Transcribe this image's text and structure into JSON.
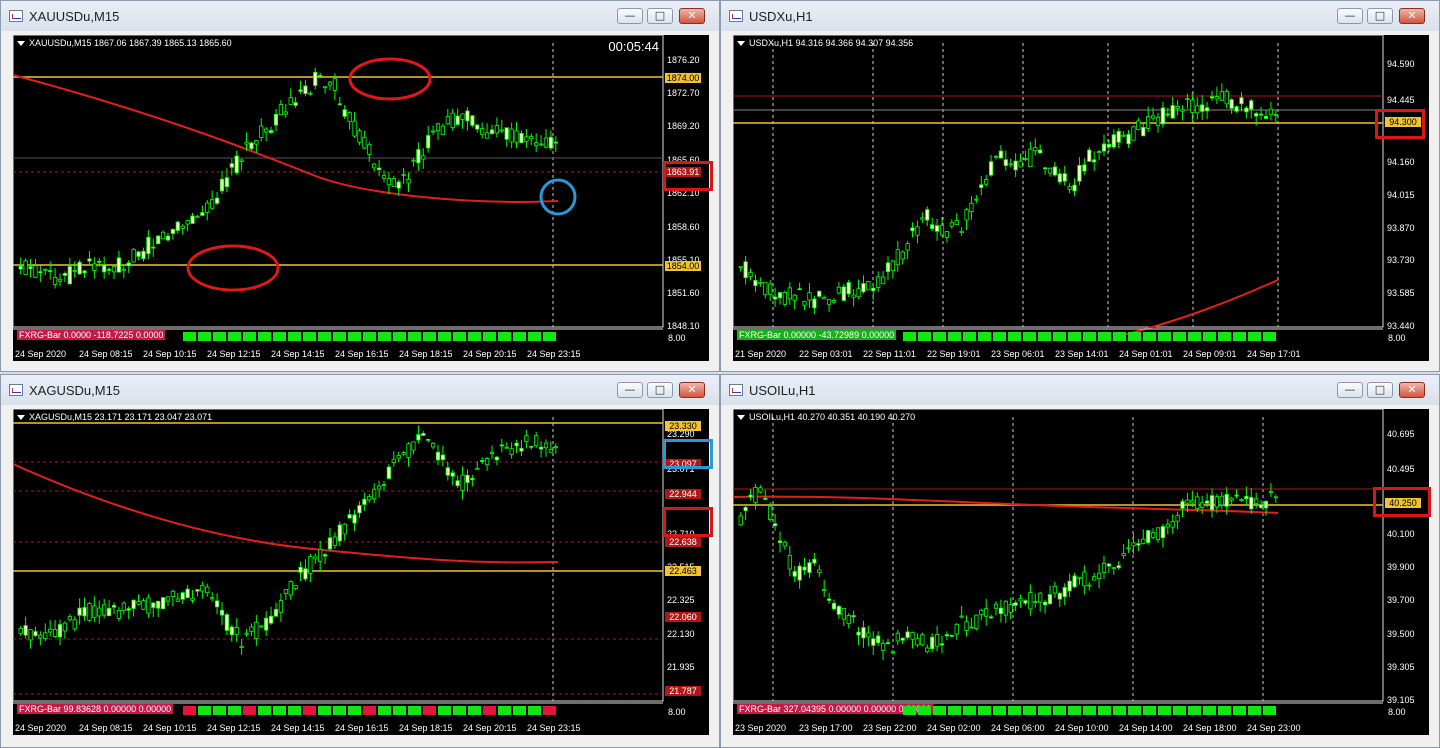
{
  "windows": [
    {
      "id": "xauusd",
      "title": "XAUUSDu,M15",
      "ohlc": "XAUUSDu,M15  1867.06 1867.39 1865.13 1865.60",
      "timer": "00:05:44",
      "indicator": "FXRG-Bar 0.0000 -118.7225 0.0000",
      "price_labels": [
        "1876.20",
        "1872.70",
        "1869.20",
        "1865.60",
        "1862.10",
        "1858.60",
        "1855.10",
        "1851.60",
        "1848.10"
      ],
      "tags": [
        {
          "text": "1874.00",
          "color": "yellow"
        },
        {
          "text": "1863.91",
          "color": "red"
        },
        {
          "text": "1854.00",
          "color": "yellow"
        }
      ],
      "x_labels": [
        "24 Sep 2020",
        "24 Sep 08:15",
        "24 Sep 10:15",
        "24 Sep 12:15",
        "24 Sep 14:15",
        "24 Sep 16:15",
        "24 Sep 18:15",
        "24 Sep 20:15",
        "24 Sep 23:15"
      ],
      "scale_end": "8.00"
    },
    {
      "id": "usdx",
      "title": "USDXu,H1",
      "ohlc": "USDXu,H1  94.316 94.366 94.307 94.356",
      "timer": "",
      "indicator": "FXRG-Bar 0.00000 -43.72989 0.00000",
      "price_labels": [
        "94.590",
        "94.445",
        "94.160",
        "94.015",
        "93.870",
        "93.730",
        "93.585",
        "93.440"
      ],
      "tags": [
        {
          "text": "94.300",
          "color": "yellow"
        }
      ],
      "x_labels": [
        "21 Sep 2020",
        "22 Sep 03:01",
        "22 Sep 11:01",
        "22 Sep 19:01",
        "23 Sep 06:01",
        "23 Sep 14:01",
        "24 Sep 01:01",
        "24 Sep 09:01",
        "24 Sep 17:01"
      ],
      "scale_end": "8.00"
    },
    {
      "id": "xagusd",
      "title": "XAGUSDu,M15",
      "ohlc": "XAGUSDu,M15  23.171 23.171 23.047 23.071",
      "timer": "",
      "indicator": "FXRG-Bar 99.83628 0.00000 0.00000",
      "price_labels": [
        "23.290",
        "23.071",
        "22.710",
        "22.515",
        "22.325",
        "22.130",
        "21.935"
      ],
      "tags": [
        {
          "text": "23.330",
          "color": "yellow"
        },
        {
          "text": "23.097",
          "color": "red"
        },
        {
          "text": "22.944",
          "color": "red"
        },
        {
          "text": "22.638",
          "color": "red"
        },
        {
          "text": "22.463",
          "color": "yellow"
        },
        {
          "text": "22.060",
          "color": "red"
        },
        {
          "text": "21.787",
          "color": "red"
        }
      ],
      "x_labels": [
        "24 Sep 2020",
        "24 Sep 08:15",
        "24 Sep 10:15",
        "24 Sep 12:15",
        "24 Sep 14:15",
        "24 Sep 16:15",
        "24 Sep 18:15",
        "24 Sep 20:15",
        "24 Sep 23:15"
      ],
      "scale_end": "8.00"
    },
    {
      "id": "usoil",
      "title": "USOILu,H1",
      "ohlc": "USOILu,H1  40.270 40.351 40.190 40.270",
      "timer": "",
      "indicator": "FXRG-Bar 327.04395 0.00000 0.00000 0.20000",
      "price_labels": [
        "40.695",
        "40.495",
        "40.100",
        "39.900",
        "39.700",
        "39.500",
        "39.305",
        "39.105"
      ],
      "tags": [
        {
          "text": "40.250",
          "color": "yellow"
        }
      ],
      "x_labels": [
        "23 Sep 2020",
        "23 Sep 17:00",
        "23 Sep 22:00",
        "24 Sep 02:00",
        "24 Sep 06:00",
        "24 Sep 10:00",
        "24 Sep 14:00",
        "24 Sep 18:00",
        "24 Sep 23:00"
      ],
      "scale_end": "8.00"
    }
  ],
  "controls": {
    "minimize": "—",
    "maximize": "□",
    "close": "✕"
  },
  "colors": {
    "bull": "#ffffcc",
    "bear": "#000000",
    "wick": "#00ff00",
    "ma": "#e02020",
    "level": "#f1c232",
    "bar_green": "#11e811",
    "bar_red": "#e0163c"
  }
}
